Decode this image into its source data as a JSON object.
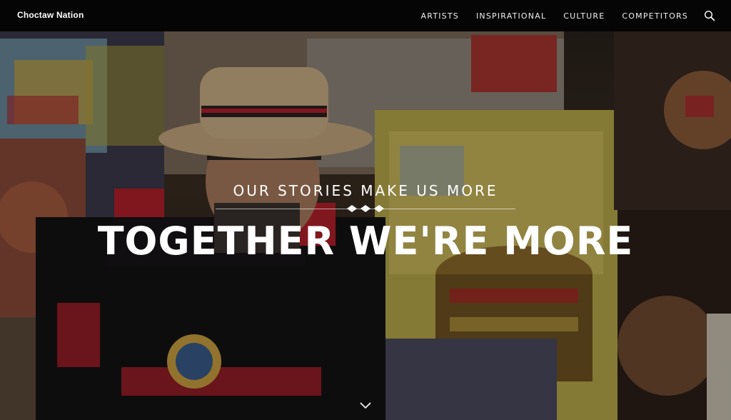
{
  "brand": "Choctaw Nation",
  "nav": {
    "items": [
      "ARTISTS",
      "INSPIRATIONAL",
      "CULTURE",
      "COMPETITORS"
    ],
    "search_icon": "search-icon"
  },
  "hero": {
    "tagline": "OUR STORIES MAKE US MORE",
    "headline": "TOGETHER WE'RE MORE",
    "divider_icon": "diamonds-icon",
    "scroll_icon": "chevron-down-icon"
  },
  "colors": {
    "nav_bg": "#050505",
    "text": "#ffffff",
    "accent_red": "#b3202a",
    "accent_yellow": "#e2c23a"
  }
}
